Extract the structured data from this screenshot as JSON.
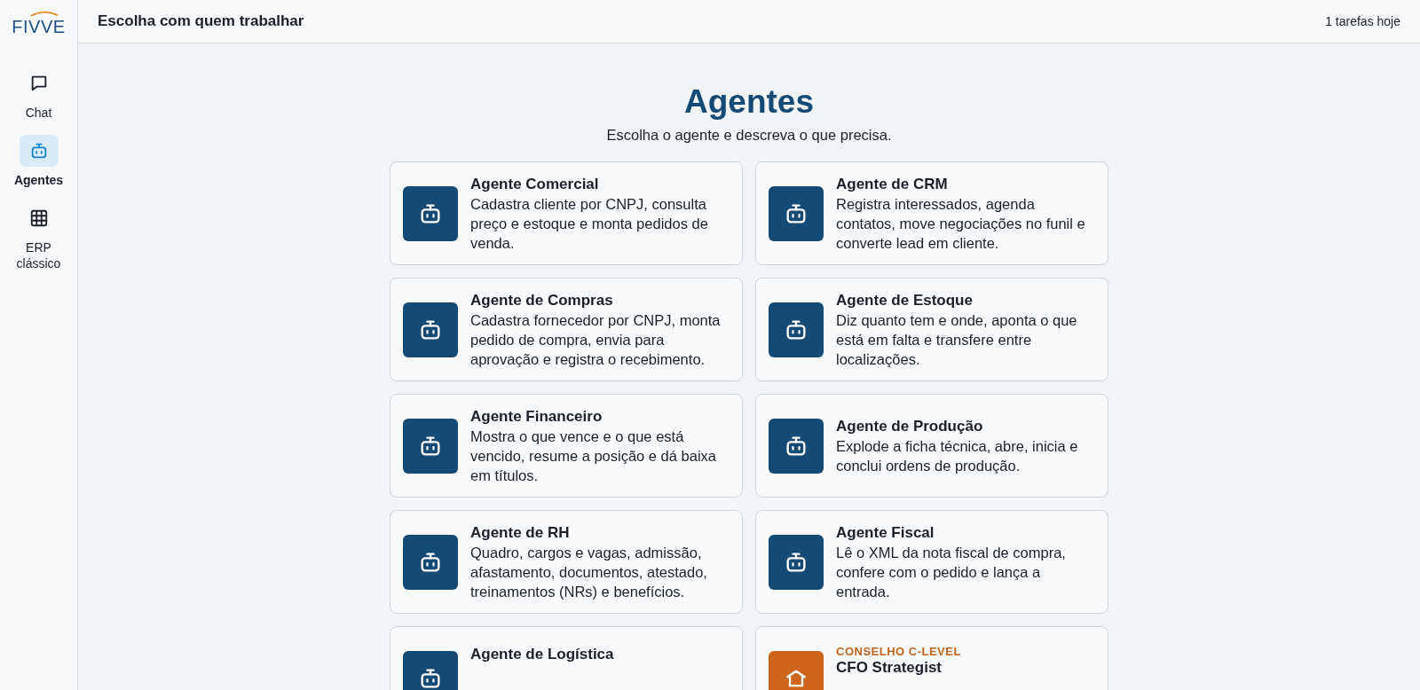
{
  "logo": {
    "text": "FIVVE"
  },
  "nav": [
    {
      "label": "Chat",
      "selected": false
    },
    {
      "label": "Agentes",
      "selected": true
    },
    {
      "label": "ERP clássico",
      "selected": false
    }
  ],
  "header": {
    "title": "Escolha com quem trabalhar",
    "tasks": "1 tarefas hoje"
  },
  "page": {
    "title": "Agentes",
    "subtitle": "Escolha o agente e descreva o que precisa."
  },
  "agents": [
    {
      "kind": "agent",
      "name": "Agente Comercial",
      "description": "Cadastra cliente por CNPJ, consulta preço e estoque e monta pedidos de venda."
    },
    {
      "kind": "agent",
      "name": "Agente de CRM",
      "description": "Registra interessados, agenda contatos, move negociações no funil e converte lead em cliente."
    },
    {
      "kind": "agent",
      "name": "Agente de Compras",
      "description": "Cadastra fornecedor por CNPJ, monta pedido de compra, envia para aprovação e registra o recebimento."
    },
    {
      "kind": "agent",
      "name": "Agente de Estoque",
      "description": "Diz quanto tem e onde, aponta o que está em falta e transfere entre localizações."
    },
    {
      "kind": "agent",
      "name": "Agente Financeiro",
      "description": "Mostra o que vence e o que está vencido, resume a posição e dá baixa em títulos."
    },
    {
      "kind": "agent",
      "name": "Agente de Produção",
      "description": "Explode a ficha técnica, abre, inicia e conclui ordens de produção."
    },
    {
      "kind": "agent",
      "name": "Agente de RH",
      "description": "Quadro, cargos e vagas, admissão, afastamento, documentos, atestado, treinamentos (NRs) e benefícios."
    },
    {
      "kind": "agent",
      "name": "Agente Fiscal",
      "description": "Lê o XML da nota fiscal de compra, confere com o pedido e lança a entrada."
    },
    {
      "kind": "agent",
      "name": "Agente de Logística"
    },
    {
      "kind": "c-level",
      "eyebrow": "CONSELHO C-LEVEL",
      "name": "CFO Strategist"
    }
  ]
}
